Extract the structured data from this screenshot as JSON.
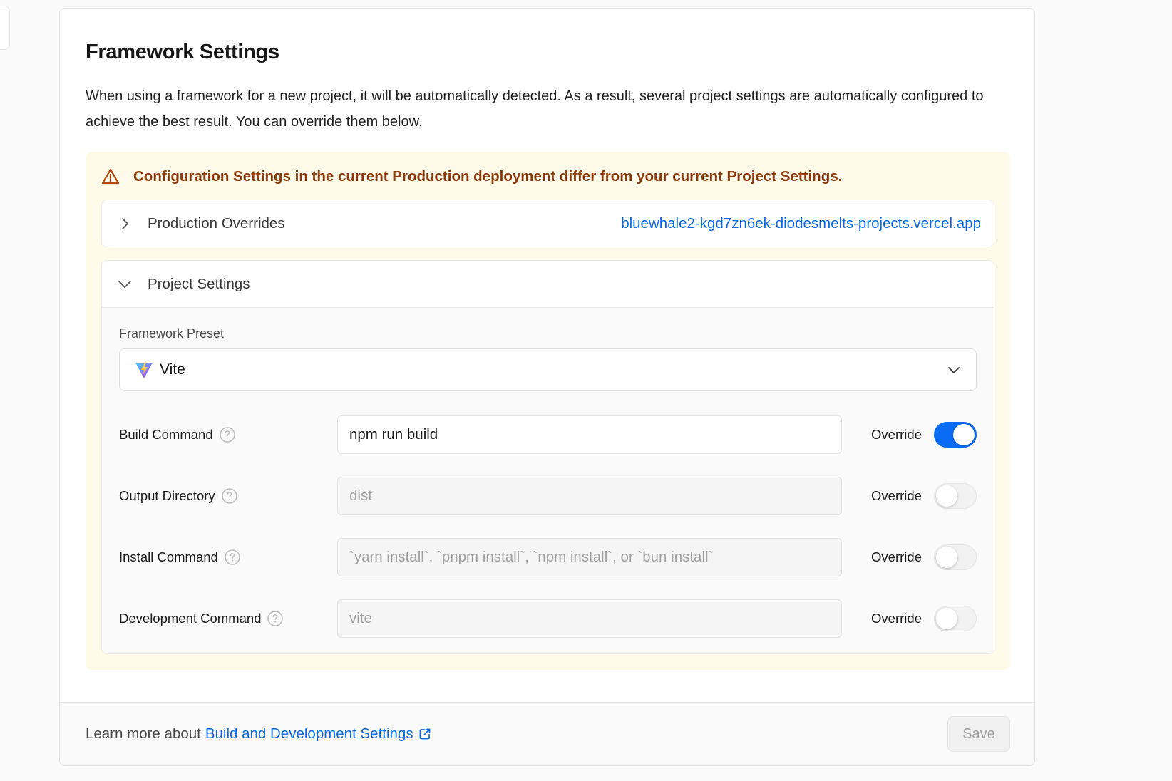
{
  "section": {
    "title": "Framework Settings",
    "description": "When using a framework for a new project, it will be automatically detected. As a result, several project settings are automatically configured to achieve the best result. You can override them below."
  },
  "warning": {
    "text": "Configuration Settings in the current Production deployment differ from your current Project Settings.",
    "icon": "warning-triangle-icon",
    "color": "#8a3a0a",
    "background": "#fefaea"
  },
  "production_overrides": {
    "label": "Production Overrides",
    "link": "bluewhale2-kgd7zn6ek-diodesmelts-projects.vercel.app",
    "expanded": false
  },
  "project_settings": {
    "label": "Project Settings",
    "expanded": true,
    "framework_preset": {
      "label": "Framework Preset",
      "value": "Vite",
      "icon": "vite-logo-icon"
    },
    "fields": [
      {
        "label": "Build Command",
        "value": "npm run build",
        "placeholder": "",
        "override_label": "Override",
        "override": true
      },
      {
        "label": "Output Directory",
        "value": "",
        "placeholder": "dist",
        "override_label": "Override",
        "override": false
      },
      {
        "label": "Install Command",
        "value": "",
        "placeholder": "`yarn install`, `pnpm install`, `npm install`, or `bun install`",
        "override_label": "Override",
        "override": false
      },
      {
        "label": "Development Command",
        "value": "",
        "placeholder": "vite",
        "override_label": "Override",
        "override": false
      }
    ]
  },
  "footer": {
    "learn_prefix": "Learn more about",
    "learn_link": "Build and Development Settings",
    "save_label": "Save"
  },
  "colors": {
    "accent": "#0a6cf5",
    "link": "#0a67e0"
  }
}
